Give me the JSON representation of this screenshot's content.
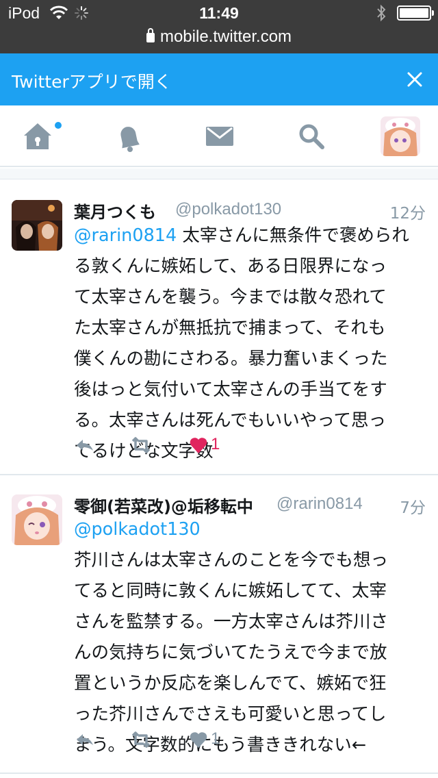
{
  "status_bar": {
    "carrier": "iPod",
    "time": "11:49"
  },
  "browser": {
    "url": "mobile.twitter.com"
  },
  "banner": {
    "label": "Twitterアプリで開く"
  },
  "nav": {
    "items": [
      "home-icon",
      "notifications-icon",
      "messages-icon",
      "search-icon",
      "profile-avatar"
    ],
    "accent": "#1da1f2"
  },
  "tweets": [
    {
      "name": "葉月つくも",
      "handle": "@polkadot130",
      "time": "12分",
      "mention": "@rarin0814",
      "lines": [
        " 太宰さんに無条件で褒められ",
        "る敦くんに嫉妬して、ある日限界になっ",
        "て太宰さんを襲う。今までは散々恐れて",
        "た太宰さんが無抵抗で捕まって、それも",
        "僕くんの勘にさわる。暴力奮いまくった",
        "後はっと気付いて太宰さんの手当てをす",
        "る。太宰さんは死んでもいいやって思っ",
        "てるけどな文字数"
      ],
      "like_count": "1",
      "liked": true
    },
    {
      "name": "零御(若菜改)@垢移転中",
      "handle": "@rarin0814",
      "time": "7分",
      "mention": "@polkadot130",
      "lines": [
        "芥川さんは太宰さんのことを今でも想っ",
        "てると同時に敦くんに嫉妬してて、太宰",
        "さんを監禁する。一方太宰さんは芥川さ",
        "んの気持ちに気づいてたうえで今まで放",
        "置というか反応を楽しんでて、嫉妬で狂",
        "った芥川さんでさえも可愛いと思ってし",
        "まう。文字数的にもう書ききれない←"
      ],
      "like_count": "1",
      "liked": false
    }
  ],
  "colors": {
    "accent": "#1da1f2",
    "muted": "#8899a6",
    "like": "#e0245e",
    "status_bg": "#3c3c3c"
  }
}
